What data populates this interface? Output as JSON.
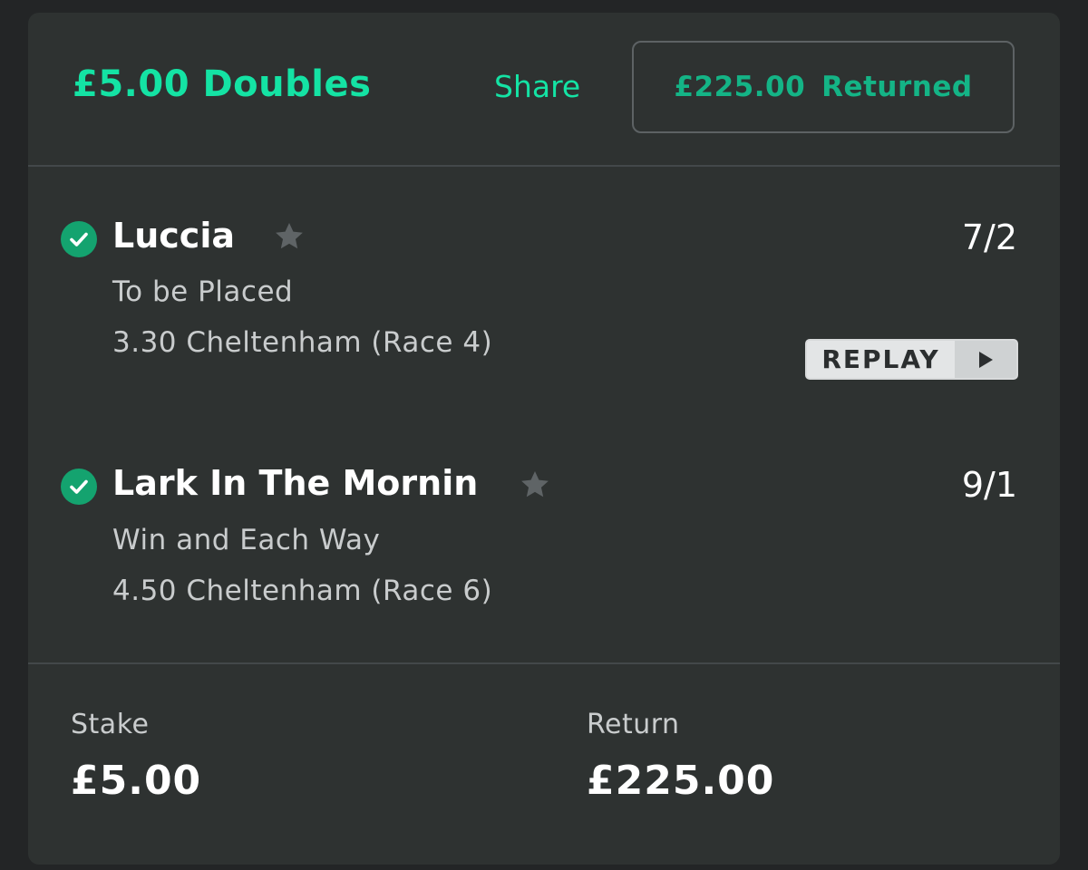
{
  "header": {
    "title": "£5.00 Doubles",
    "share_label": "Share",
    "returned_amount": "£225.00",
    "returned_label": "Returned"
  },
  "selections": [
    {
      "horse": "Luccia",
      "odds": "7/2",
      "market": "To be Placed",
      "event": "3.30 Cheltenham (Race 4)",
      "status": "won",
      "replay_label": "REPLAY"
    },
    {
      "horse": "Lark In The Mornin",
      "odds": "9/1",
      "market": "Win and Each Way",
      "event": "4.50 Cheltenham (Race 6)",
      "status": "won"
    }
  ],
  "footer": {
    "stake_label": "Stake",
    "stake_value": "£5.00",
    "return_label": "Return",
    "return_value": "£225.00"
  },
  "colors": {
    "accent": "#14e3a4",
    "returned_text": "#14b486",
    "check": "#14a36f",
    "card_bg": "#2e3231",
    "page_bg": "#232526"
  },
  "icons": {
    "check": "check-circle-icon",
    "favourite": "star-icon",
    "play": "play-icon"
  }
}
